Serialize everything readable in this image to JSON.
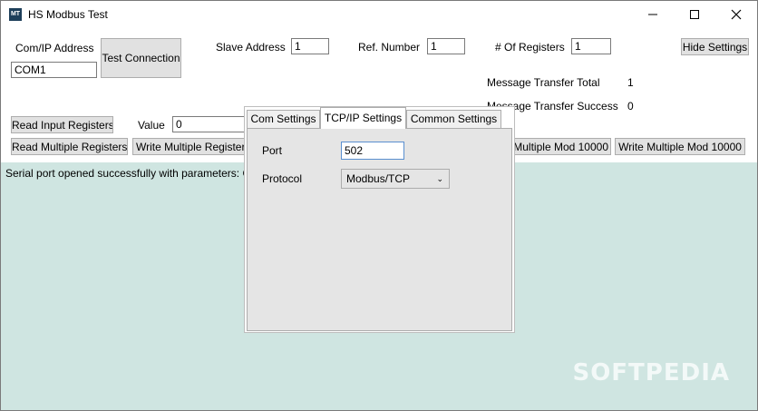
{
  "window": {
    "title": "HS Modbus Test",
    "icon_text": "MT"
  },
  "connection": {
    "com_ip_label": "Com/IP Address",
    "com_ip_value": "COM1",
    "test_button": "Test Connection"
  },
  "fields": {
    "slave_label": "Slave Address",
    "slave_value": "1",
    "ref_label": "Ref. Number",
    "ref_value": "1",
    "regs_label": "# Of Registers",
    "regs_value": "1"
  },
  "hide_settings_button": "Hide Settings",
  "stats": {
    "total_label": "Message Transfer Total",
    "total_value": "1",
    "success_label": "Message Transfer Success",
    "success_value": "0"
  },
  "actions": {
    "read_input": "Read Input Registers",
    "value_label": "Value",
    "value_input": "0",
    "read_multiple": "Read Multiple Registers",
    "write_multiple": "Write Multiple Registers",
    "multiple_mod": "Multiple Mod 10000",
    "write_multiple_mod": "Write Multiple Mod 10000"
  },
  "output": {
    "line": "Serial port opened successfully with parameters: C"
  },
  "settings_panel": {
    "tabs": [
      "Com Settings",
      "TCP/IP Settings",
      "Common Settings"
    ],
    "active_tab": "TCP/IP Settings",
    "port_label": "Port",
    "port_value": "502",
    "protocol_label": "Protocol",
    "protocol_value": "Modbus/TCP"
  },
  "watermark": "SOFTPEDIA",
  "colors": {
    "output_bg": "#cfe5e1",
    "button_bg": "#e1e1e1",
    "panel_bg": "#e5e5e5"
  }
}
